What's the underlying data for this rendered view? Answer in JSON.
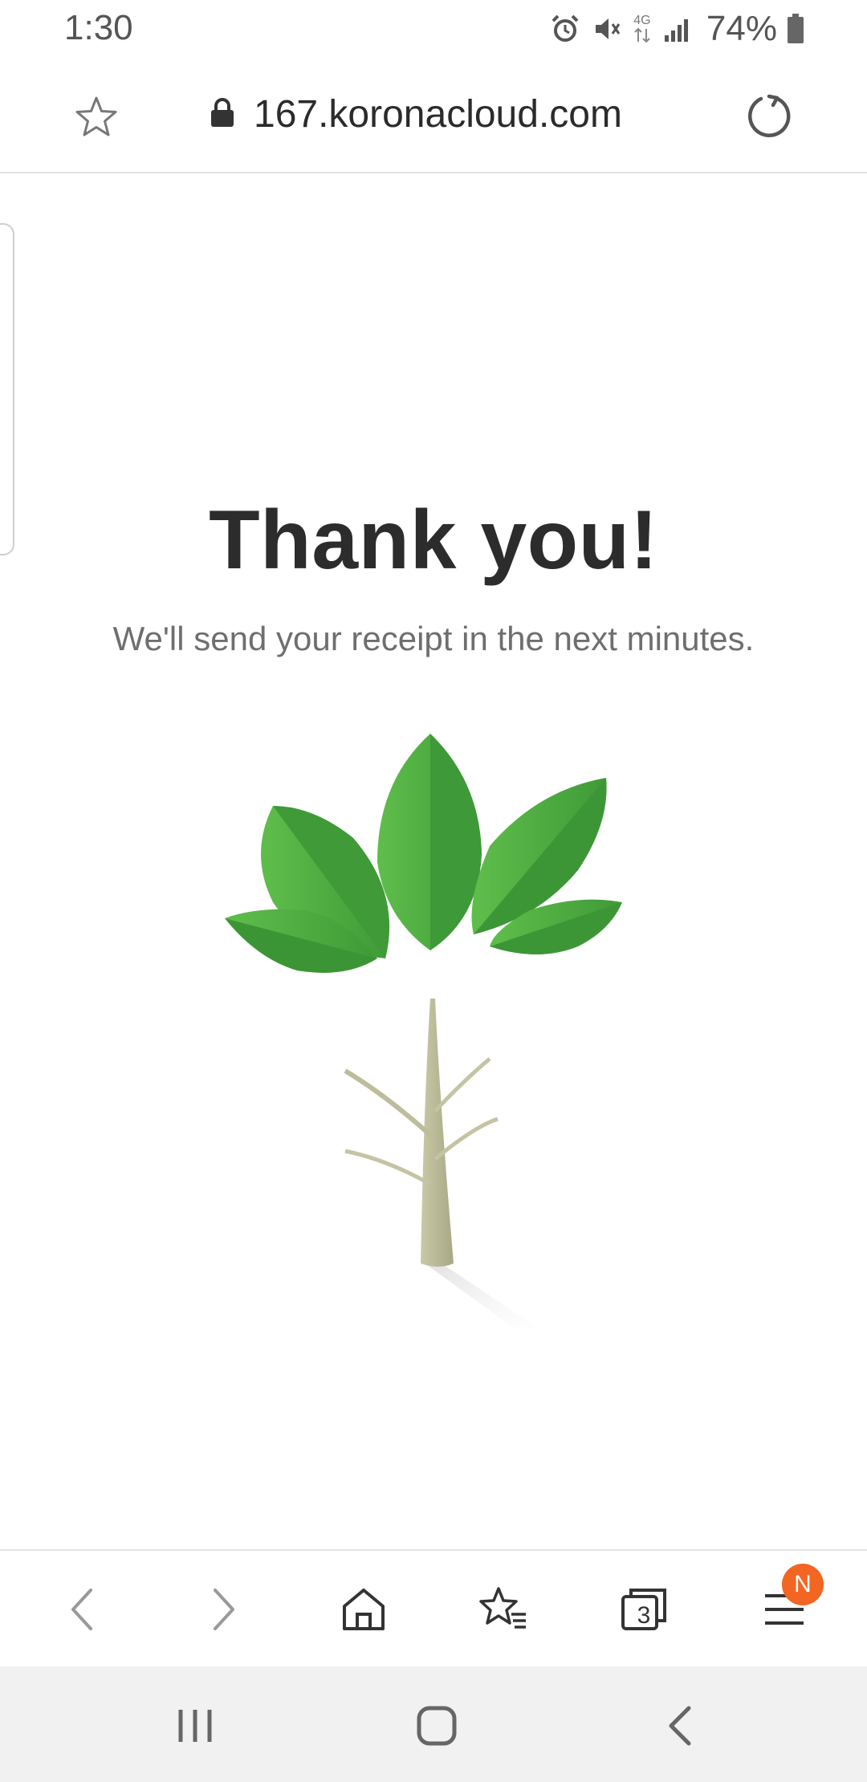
{
  "status_bar": {
    "time": "1:30",
    "network_label": "4G",
    "battery_percent": "74%"
  },
  "browser": {
    "url": "167.koronacloud.com",
    "open_tabs": "3",
    "menu_badge": "N",
    "colors": {
      "badge": "#f26522",
      "accent": "#4caf50"
    }
  },
  "page": {
    "title": "Thank you!",
    "subtitle": "We'll send your receipt in the next minutes."
  },
  "icons": {
    "status": [
      "alarm-icon",
      "mute-icon",
      "network-4g-icon",
      "signal-icon",
      "battery-icon"
    ],
    "toolbar": [
      "back-icon",
      "forward-icon",
      "home-icon",
      "bookmarks-icon",
      "tabs-icon",
      "menu-icon"
    ],
    "nav": [
      "recents-icon",
      "home-nav-icon",
      "back-nav-icon"
    ]
  }
}
